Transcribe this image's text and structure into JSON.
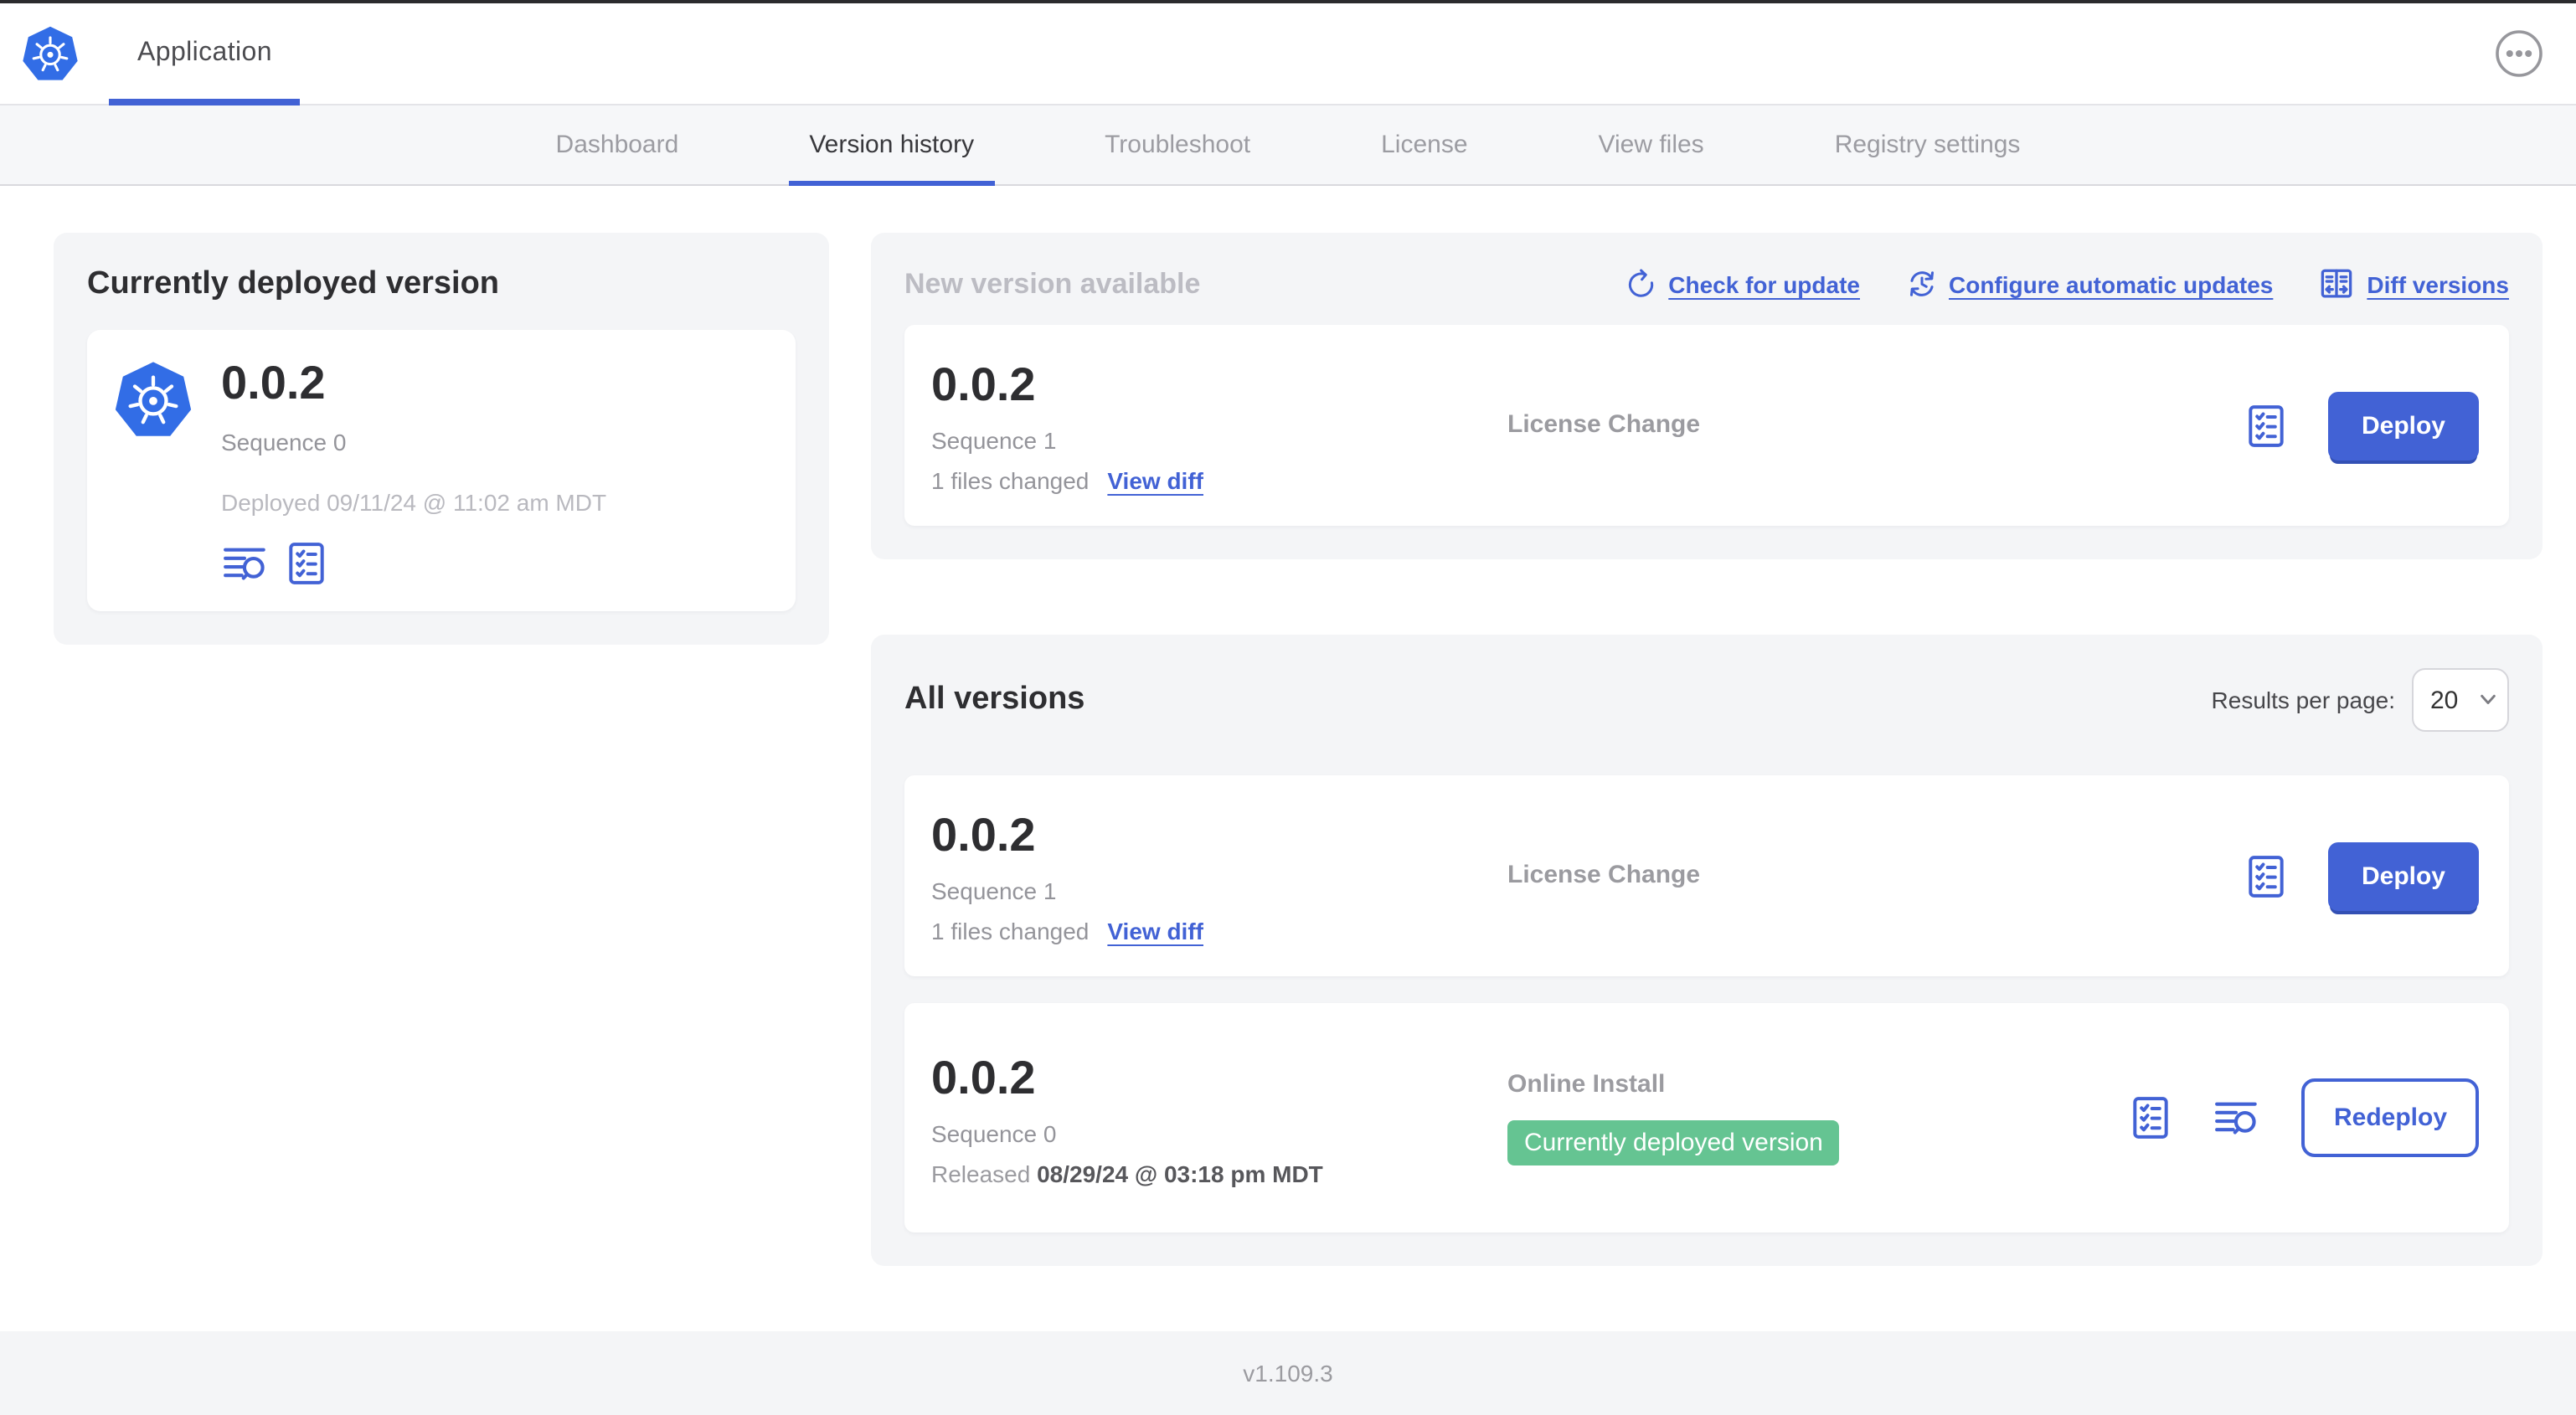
{
  "colors": {
    "accent_blue": "#4262d5",
    "kubernetes_blue": "#326de6",
    "badge_green": "#65c492",
    "panel_gray": "#f4f5f7"
  },
  "header": {
    "app_tab": "Application"
  },
  "nav": {
    "active": "Version history",
    "tabs": [
      "Dashboard",
      "Version history",
      "Troubleshoot",
      "License",
      "View files",
      "Registry settings"
    ]
  },
  "currently_deployed": {
    "title": "Currently deployed version",
    "version": "0.0.2",
    "sequence": "Sequence 0",
    "deployed": "Deployed 09/11/24 @ 11:02 am MDT"
  },
  "new_version": {
    "title": "New version available",
    "check_for_update": "Check for update",
    "configure_auto_updates": "Configure automatic updates",
    "diff_versions": "Diff versions",
    "card": {
      "version": "0.0.2",
      "sequence": "Sequence 1",
      "files_changed": "1 files changed",
      "view_diff": "View diff",
      "type": "License Change",
      "action": "Deploy"
    }
  },
  "all_versions": {
    "title": "All versions",
    "results_per_page_label": "Results per page:",
    "results_per_page": "20",
    "rows": [
      {
        "version": "0.0.2",
        "sequence": "Sequence 1",
        "files_changed": "1 files changed",
        "view_diff": "View diff",
        "type": "License Change",
        "action": "Deploy"
      },
      {
        "version": "0.0.2",
        "sequence": "Sequence 0",
        "released_label": "Released",
        "released_date": "08/29/24 @ 03:18 pm MDT",
        "type": "Online Install",
        "badge": "Currently deployed version",
        "action": "Redeploy"
      }
    ]
  },
  "footer": {
    "version": "v1.109.3"
  }
}
